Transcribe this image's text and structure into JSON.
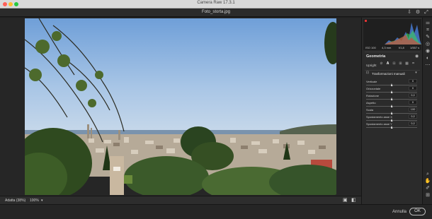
{
  "window": {
    "app_title": "Camera Raw 17.3.1",
    "file_title": "Foto_storta.jpg"
  },
  "top_icons": {
    "save": "save-icon",
    "settings": "gear-icon",
    "expand": "expand-icon"
  },
  "histogram": {
    "readouts": [
      "ISO 100",
      "4,3 mm",
      "f/1,8",
      "1/557 s"
    ],
    "colors": {
      "red": "#e33b3b",
      "green": "#3fcf5a",
      "blue": "#4f8cf5"
    }
  },
  "geometry": {
    "title": "Geometria",
    "upright_label": "Upright",
    "upright_options": [
      "off-icon",
      "auto-icon",
      "level-icon",
      "vertical-icon",
      "full-icon",
      "guided-icon"
    ],
    "manual_header": "Trasformazioni manuali",
    "sliders": [
      {
        "label": "Verticale",
        "value": "0",
        "fraction": 0.5
      },
      {
        "label": "Orizzontale",
        "value": "0",
        "fraction": 0.5
      },
      {
        "label": "Rotazione",
        "value": "0,0",
        "fraction": 0.5
      },
      {
        "label": "Aspetto",
        "value": "0",
        "fraction": 0.5
      },
      {
        "label": "Scala",
        "value": "100",
        "fraction": 0.5
      },
      {
        "label": "Spostamento asse X",
        "value": "0,0",
        "fraction": 0.5
      },
      {
        "label": "Spostamento asse Y",
        "value": "0,0",
        "fraction": 0.5
      }
    ]
  },
  "bottombar": {
    "fit_label": "Adatta (38%)",
    "zoom_100": "100%"
  },
  "footer": {
    "cancel_label": "Annulla",
    "ok_label": "OK"
  },
  "tools": [
    "edit-icon",
    "crop-icon",
    "healing-icon",
    "mask-icon",
    "redeye-icon",
    "presets-icon",
    "more-icon"
  ],
  "bottom_tools": [
    "zoom-icon",
    "hand-icon",
    "sampler-icon",
    "grid-icon"
  ]
}
